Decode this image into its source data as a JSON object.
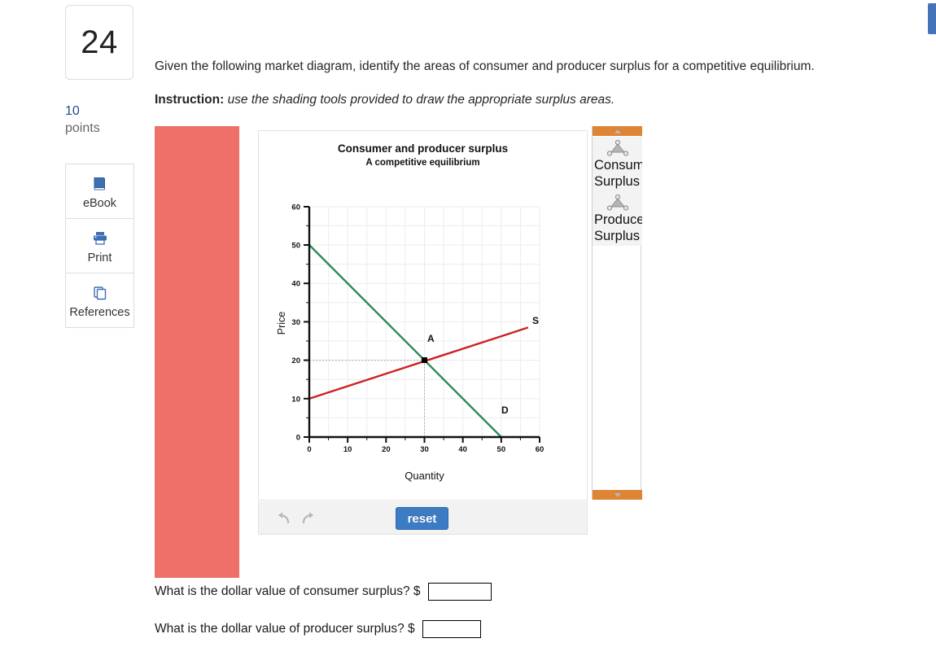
{
  "question": {
    "number": "24",
    "points_value": "10",
    "points_label": "points",
    "prompt": "Given the following market diagram, identify the areas of consumer and producer surplus for a competitive equilibrium.",
    "instruction_label": "Instruction:",
    "instruction_text": "use the shading tools provided to draw the appropriate surplus areas."
  },
  "sidebar": {
    "items": [
      {
        "label": "eBook",
        "icon": "book-icon"
      },
      {
        "label": "Print",
        "icon": "printer-icon"
      },
      {
        "label": "References",
        "icon": "copies-icon"
      }
    ]
  },
  "chart_toolbar": {
    "undo_icon": "undo-arrow-icon",
    "redo_icon": "redo-arrow-icon",
    "reset_label": "reset"
  },
  "palette": {
    "scroll_up_icon": "chevron-up-icon",
    "scroll_down_icon": "chevron-down-icon",
    "tools": [
      {
        "label_line1": "Consumer",
        "label_line2": "Surplus",
        "icon": "shading-triangle-icon"
      },
      {
        "label_line1": "Producer",
        "label_line2": "Surplus",
        "icon": "shading-triangle-icon"
      }
    ]
  },
  "sub_questions": [
    {
      "text": "What is the dollar value of consumer surplus? $",
      "value": "",
      "placeholder": ""
    },
    {
      "text": "What is the dollar value of producer surplus? $",
      "value": "",
      "placeholder": ""
    }
  ],
  "colors": {
    "demand_line": "#2e8b57",
    "supply_line": "#cc2222",
    "accent_blue": "#3c7cc4",
    "palette_orange": "#dd8534",
    "overlay_salmon": "#ee7069"
  },
  "chart_data": {
    "type": "line",
    "title": "Consumer and producer surplus",
    "subtitle": "A competitive equilibrium",
    "xlabel": "Quantity",
    "ylabel": "Price",
    "xlim": [
      0,
      60
    ],
    "ylim": [
      0,
      60
    ],
    "xticks": [
      0,
      10,
      20,
      30,
      40,
      50,
      60
    ],
    "yticks": [
      0,
      10,
      20,
      30,
      40,
      50,
      60
    ],
    "grid": true,
    "legend": "none",
    "series": [
      {
        "name": "D",
        "label": "D",
        "color": "#2e8b57",
        "points": [
          {
            "x": 0,
            "y": 50
          },
          {
            "x": 50,
            "y": 0
          }
        ]
      },
      {
        "name": "S",
        "label": "S",
        "color": "#cc2222",
        "points": [
          {
            "x": 0,
            "y": 10
          },
          {
            "x": 57,
            "y": 28.5
          }
        ]
      }
    ],
    "annotations": [
      {
        "label": "A",
        "x": 30,
        "y": 20,
        "type": "equilibrium-point"
      },
      {
        "label": "D",
        "x": 44,
        "y": 7,
        "type": "series-label"
      },
      {
        "label": "S",
        "x": 58,
        "y": 30,
        "type": "series-label"
      }
    ],
    "guides": [
      {
        "type": "horizontal-dotted",
        "y": 20,
        "from_x": 0,
        "to_x": 30
      },
      {
        "type": "vertical-dotted",
        "x": 30,
        "from_y": 0,
        "to_y": 20
      }
    ]
  }
}
